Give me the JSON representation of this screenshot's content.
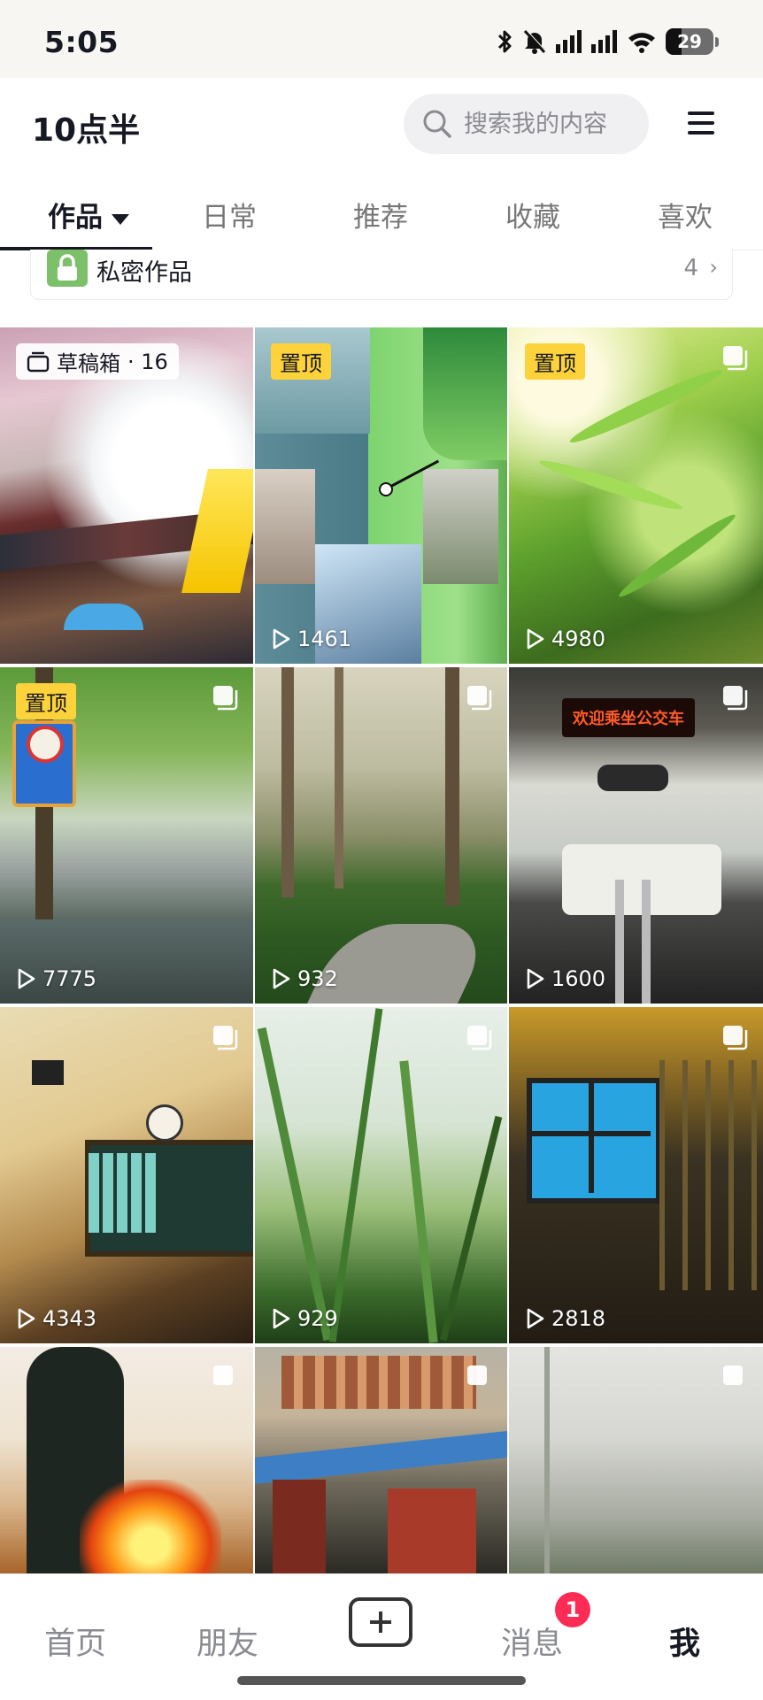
{
  "status_bar": {
    "time": "5:05",
    "battery": "29",
    "icons": [
      "bluetooth-icon",
      "mute-bell-icon",
      "signal-icon",
      "signal-icon",
      "wifi-icon",
      "battery-icon"
    ]
  },
  "header": {
    "username": "10点半",
    "search_placeholder": "搜索我的内容",
    "menu_icon": "hamburger-icon"
  },
  "tabs": [
    {
      "label": "作品",
      "active": true
    },
    {
      "label": "日常"
    },
    {
      "label": "推荐"
    },
    {
      "label": "收藏"
    },
    {
      "label": "喜欢"
    }
  ],
  "private_works": {
    "label": "私密作品",
    "count": "4"
  },
  "grid": {
    "draft": {
      "label": "草稿箱",
      "count": "· 16"
    },
    "pin_label": "置顶",
    "items": [
      {
        "plays": ""
      },
      {
        "plays": "1461"
      },
      {
        "plays": "4980"
      },
      {
        "plays": "7775"
      },
      {
        "plays": "932"
      },
      {
        "plays": "1600"
      },
      {
        "plays": "4343"
      },
      {
        "plays": "929"
      },
      {
        "plays": "2818"
      },
      {
        "plays": ""
      },
      {
        "plays": ""
      },
      {
        "plays": ""
      }
    ],
    "bus_sign": "欢迎乘坐公交车"
  },
  "bottom_nav": {
    "home": "首页",
    "friends": "朋友",
    "messages": "消息",
    "messages_badge": "1",
    "me": "我"
  },
  "colors": {
    "accent_badge": "#fe2c55",
    "pin_tag": "#fed23a",
    "text_primary": "#161823",
    "text_secondary": "#8a8b91"
  }
}
